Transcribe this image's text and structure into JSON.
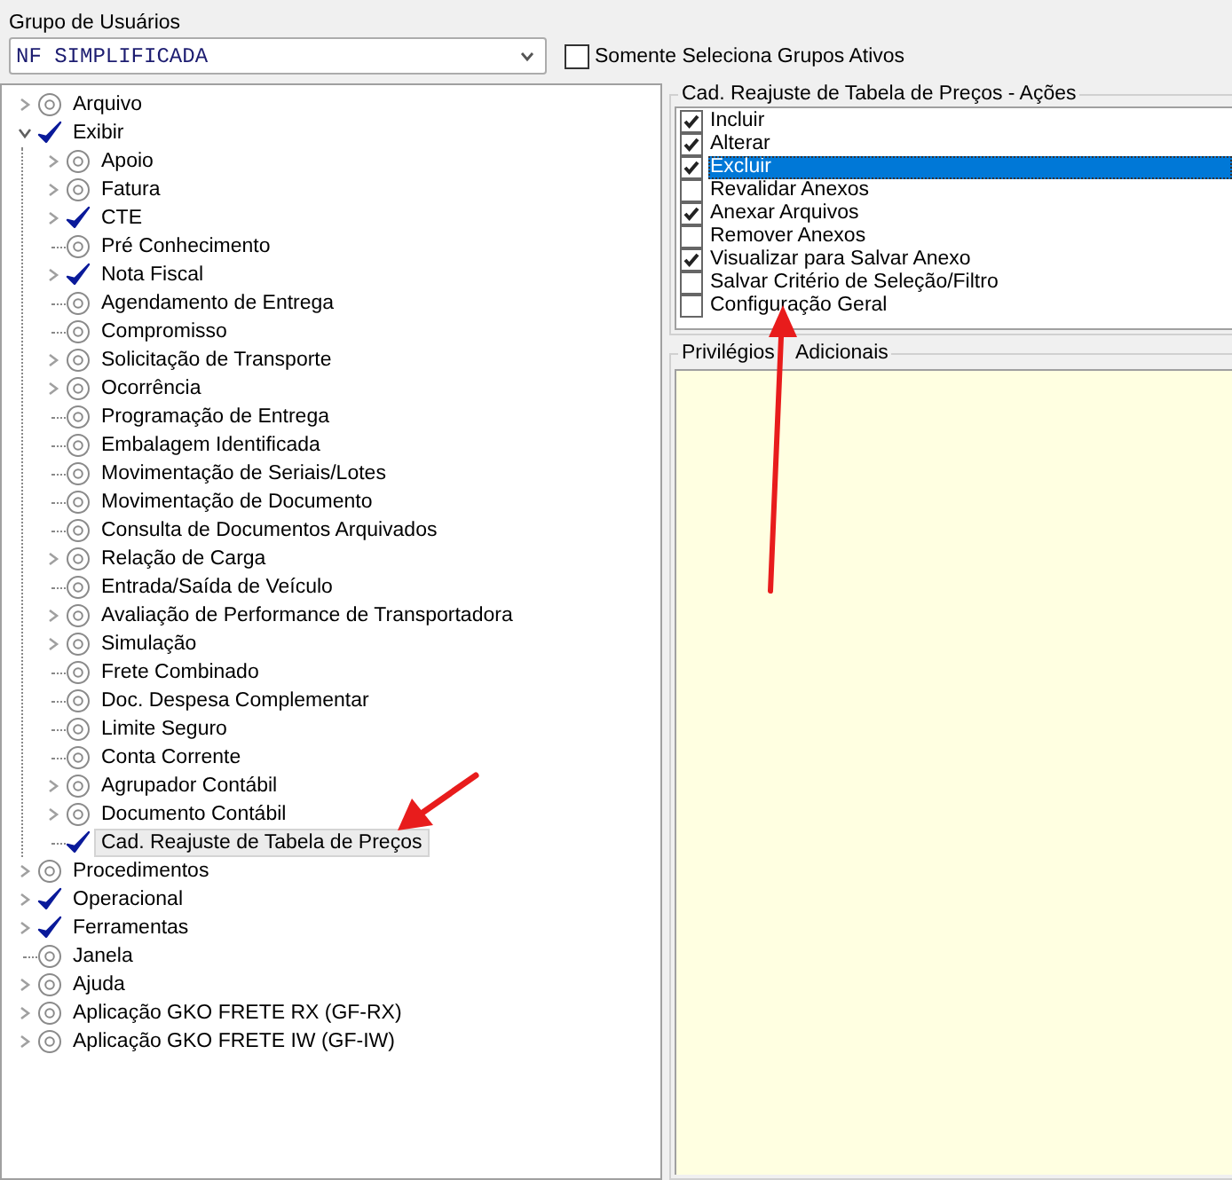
{
  "group_selector": {
    "label": "Grupo de Usuários",
    "value": "NF SIMPLIFICADA",
    "active_only": {
      "label": "Somente Seleciona Grupos Ativos",
      "checked": false
    }
  },
  "tree": {
    "items": [
      {
        "label": "Arquivo",
        "granted": false,
        "expanded": false,
        "selected": false
      },
      {
        "label": "Exibir",
        "granted": true,
        "expanded": true,
        "selected": false,
        "children": [
          {
            "label": "Apoio",
            "granted": false,
            "expanded": false,
            "selected": false
          },
          {
            "label": "Fatura",
            "granted": false,
            "expanded": false,
            "selected": false
          },
          {
            "label": "CTE",
            "granted": true,
            "expanded": false,
            "selected": false
          },
          {
            "label": "Pré Conhecimento",
            "granted": false,
            "selected": false
          },
          {
            "label": "Nota Fiscal",
            "granted": true,
            "expanded": false,
            "selected": false
          },
          {
            "label": "Agendamento de Entrega",
            "granted": false,
            "selected": false
          },
          {
            "label": "Compromisso",
            "granted": false,
            "selected": false
          },
          {
            "label": "Solicitação de Transporte",
            "granted": false,
            "expanded": false,
            "selected": false
          },
          {
            "label": "Ocorrência",
            "granted": false,
            "expanded": false,
            "selected": false
          },
          {
            "label": "Programação de Entrega",
            "granted": false,
            "selected": false
          },
          {
            "label": "Embalagem Identificada",
            "granted": false,
            "selected": false
          },
          {
            "label": "Movimentação de Seriais/Lotes",
            "granted": false,
            "selected": false
          },
          {
            "label": "Movimentação de Documento",
            "granted": false,
            "selected": false
          },
          {
            "label": "Consulta de Documentos Arquivados",
            "granted": false,
            "selected": false
          },
          {
            "label": "Relação de Carga",
            "granted": false,
            "expanded": false,
            "selected": false
          },
          {
            "label": "Entrada/Saída de Veículo",
            "granted": false,
            "selected": false
          },
          {
            "label": "Avaliação de Performance de Transportadora",
            "granted": false,
            "expanded": false,
            "selected": false
          },
          {
            "label": "Simulação",
            "granted": false,
            "expanded": false,
            "selected": false
          },
          {
            "label": "Frete Combinado",
            "granted": false,
            "selected": false
          },
          {
            "label": "Doc. Despesa Complementar",
            "granted": false,
            "selected": false
          },
          {
            "label": "Limite Seguro",
            "granted": false,
            "selected": false
          },
          {
            "label": "Conta Corrente",
            "granted": false,
            "selected": false
          },
          {
            "label": "Agrupador Contábil",
            "granted": false,
            "expanded": false,
            "selected": false
          },
          {
            "label": "Documento Contábil",
            "granted": false,
            "expanded": false,
            "selected": false
          },
          {
            "label": "Cad. Reajuste de Tabela de Preços",
            "granted": true,
            "selected": true
          }
        ]
      },
      {
        "label": "Procedimentos",
        "granted": false,
        "expanded": false,
        "selected": false
      },
      {
        "label": "Operacional",
        "granted": true,
        "expanded": false,
        "selected": false
      },
      {
        "label": "Ferramentas",
        "granted": true,
        "expanded": false,
        "selected": false
      },
      {
        "label": "Janela",
        "granted": false,
        "selected": false
      },
      {
        "label": "Ajuda",
        "granted": false,
        "expanded": false,
        "selected": false
      },
      {
        "label": "Aplicação GKO FRETE RX (GF-RX)",
        "granted": false,
        "expanded": false,
        "selected": false
      },
      {
        "label": "Aplicação GKO FRETE IW (GF-IW)",
        "granted": false,
        "expanded": false,
        "selected": false
      }
    ]
  },
  "actions": {
    "title": "Cad. Reajuste de Tabela de Preços - Ações",
    "items": [
      {
        "label": "Incluir",
        "checked": true,
        "selected": false
      },
      {
        "label": "Alterar",
        "checked": true,
        "selected": false
      },
      {
        "label": "Excluir",
        "checked": true,
        "selected": true
      },
      {
        "label": "Revalidar Anexos",
        "checked": false,
        "selected": false
      },
      {
        "label": "Anexar Arquivos",
        "checked": true,
        "selected": false
      },
      {
        "label": "Remover Anexos",
        "checked": false,
        "selected": false
      },
      {
        "label": "Visualizar para Salvar Anexo",
        "checked": true,
        "selected": false
      },
      {
        "label": "Salvar Critério de Seleção/Filtro",
        "checked": false,
        "selected": false
      },
      {
        "label": "Configuração Geral",
        "checked": false,
        "selected": false
      }
    ]
  },
  "additional": {
    "title": "Privilégios Adicionais"
  }
}
